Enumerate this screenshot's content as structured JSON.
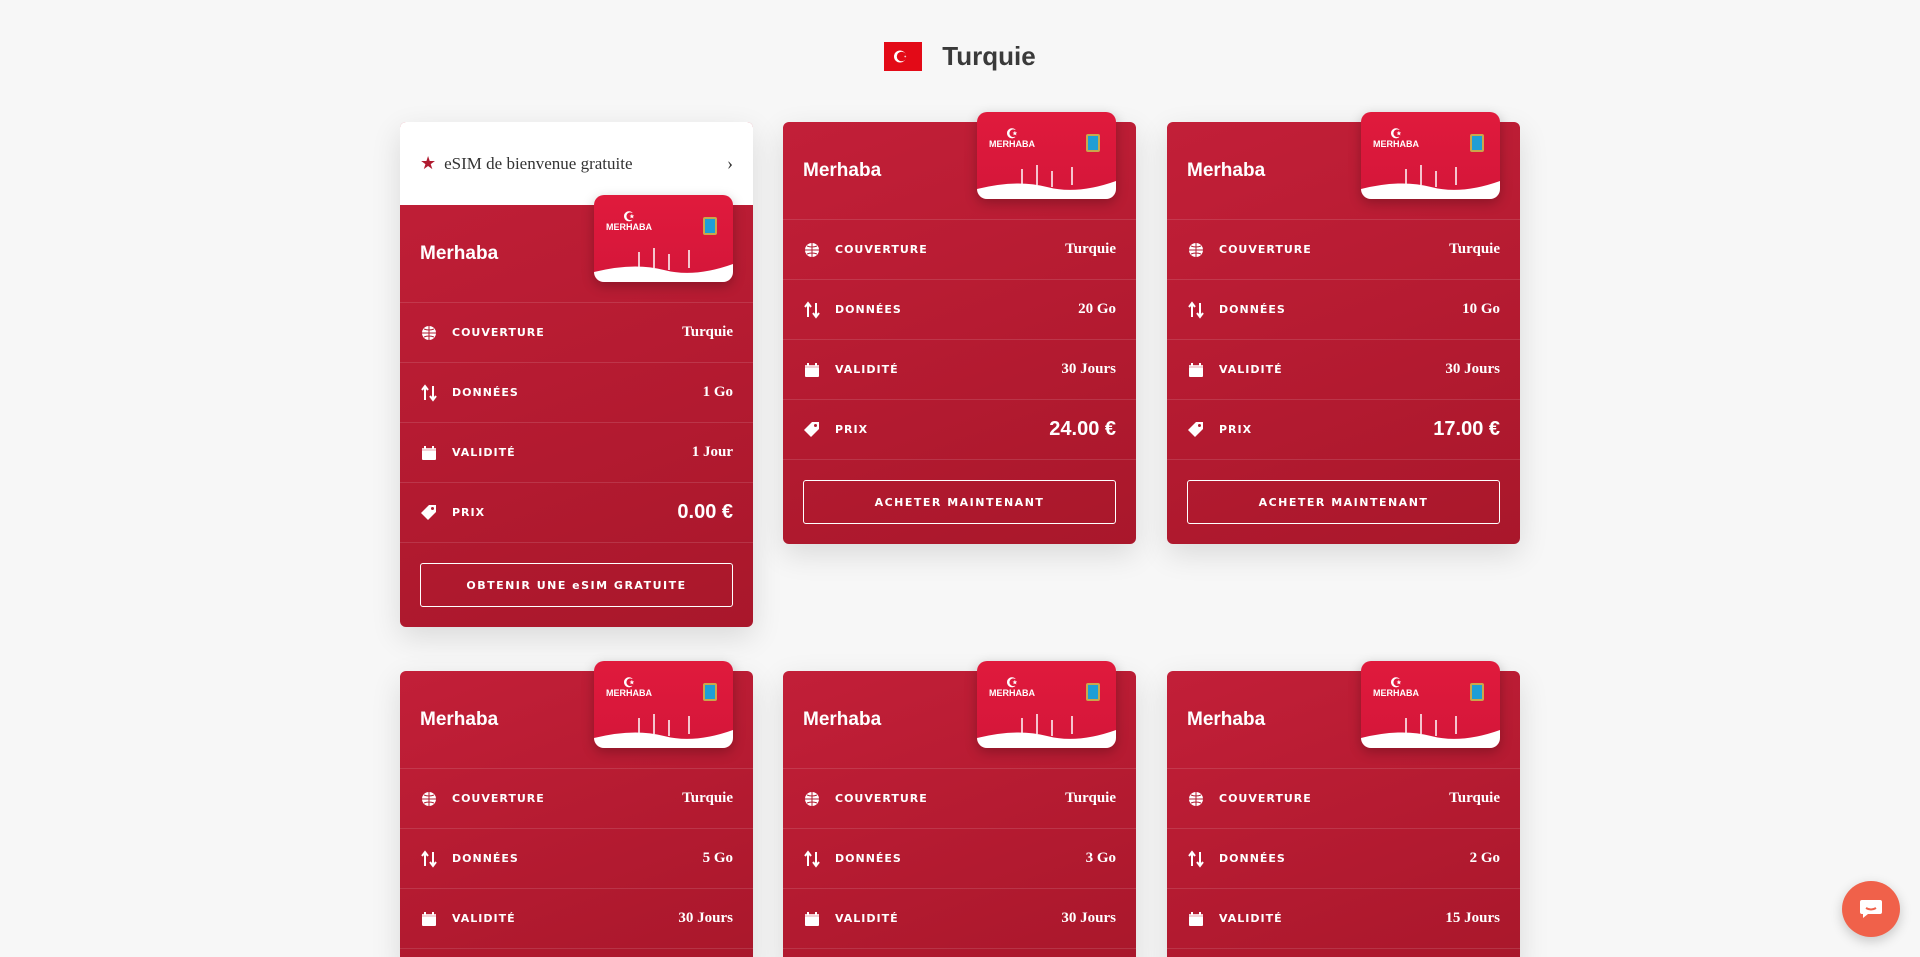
{
  "page": {
    "title": "Turquie",
    "flag_icon": "turkey-flag-icon"
  },
  "colors": {
    "card": "#b01b30",
    "accent": "#e01a3c",
    "chat": "#f0614a"
  },
  "welcome": {
    "label": "eSIM de bienvenue gratuite"
  },
  "labels": {
    "coverage": "COUVERTURE",
    "data": "DONNÉES",
    "validity": "VALIDITÉ",
    "price": "PRIX"
  },
  "card_logo_text": "MERHABA",
  "cards": [
    {
      "name": "Merhaba",
      "coverage": "Turquie",
      "data": "1 Go",
      "validity": "1 Jour",
      "price": "0.00 €",
      "button": "OBTENIR UNE eSIM GRATUITE"
    },
    {
      "name": "Merhaba",
      "coverage": "Turquie",
      "data": "20 Go",
      "validity": "30 Jours",
      "price": "24.00 €",
      "button": "ACHETER MAINTENANT"
    },
    {
      "name": "Merhaba",
      "coverage": "Turquie",
      "data": "10 Go",
      "validity": "30 Jours",
      "price": "17.00 €",
      "button": "ACHETER MAINTENANT"
    },
    {
      "name": "Merhaba",
      "coverage": "Turquie",
      "data": "5 Go",
      "validity": "30 Jours"
    },
    {
      "name": "Merhaba",
      "coverage": "Turquie",
      "data": "3 Go",
      "validity": "30 Jours"
    },
    {
      "name": "Merhaba",
      "coverage": "Turquie",
      "data": "2 Go",
      "validity": "15 Jours"
    }
  ]
}
